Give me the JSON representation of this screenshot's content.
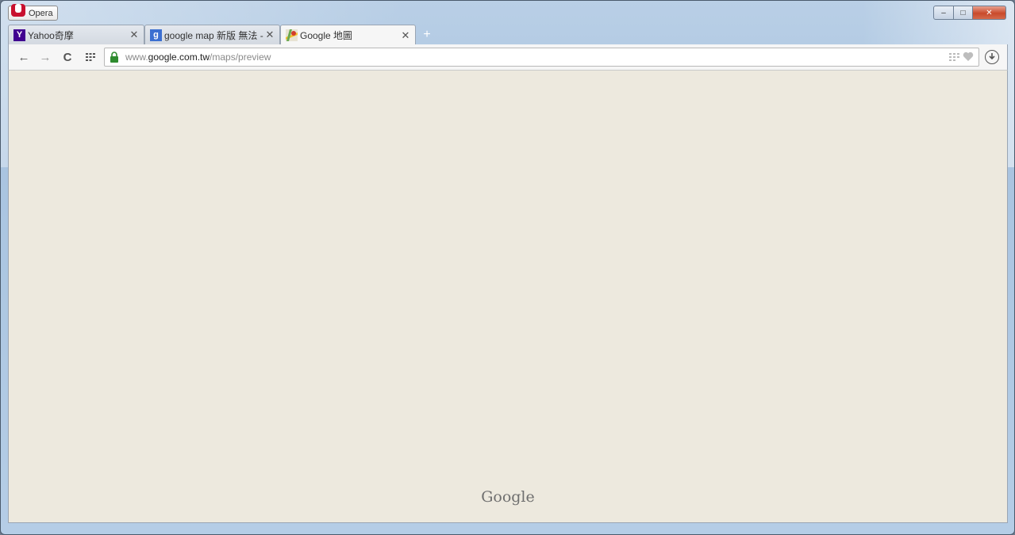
{
  "app": {
    "menu_label": "Opera"
  },
  "window_controls": {
    "minimize_glyph": "–",
    "maximize_glyph": "□",
    "close_glyph": "✕"
  },
  "tabs": [
    {
      "title": "Yahoo奇摩",
      "favicon": "yahoo-icon",
      "active": false,
      "close_glyph": "✕"
    },
    {
      "title": "google map 新版 無法 - G",
      "favicon": "google-plus-icon",
      "active": false,
      "close_glyph": "✕"
    },
    {
      "title": "Google 地圖",
      "favicon": "google-maps-icon",
      "active": true,
      "close_glyph": "✕"
    }
  ],
  "new_tab_glyph": "+",
  "toolbar": {
    "back_glyph": "←",
    "forward_glyph": "→",
    "reload_glyph": "C"
  },
  "address": {
    "prefix": "www.",
    "host": "google.com.tw",
    "path": "/maps/preview"
  },
  "content": {
    "logo_text": "Google",
    "background": "#ede9de"
  },
  "colors": {
    "yahoo": "#400090",
    "google_plus": "#3b6fd1",
    "lock": "#2e8b2e"
  }
}
